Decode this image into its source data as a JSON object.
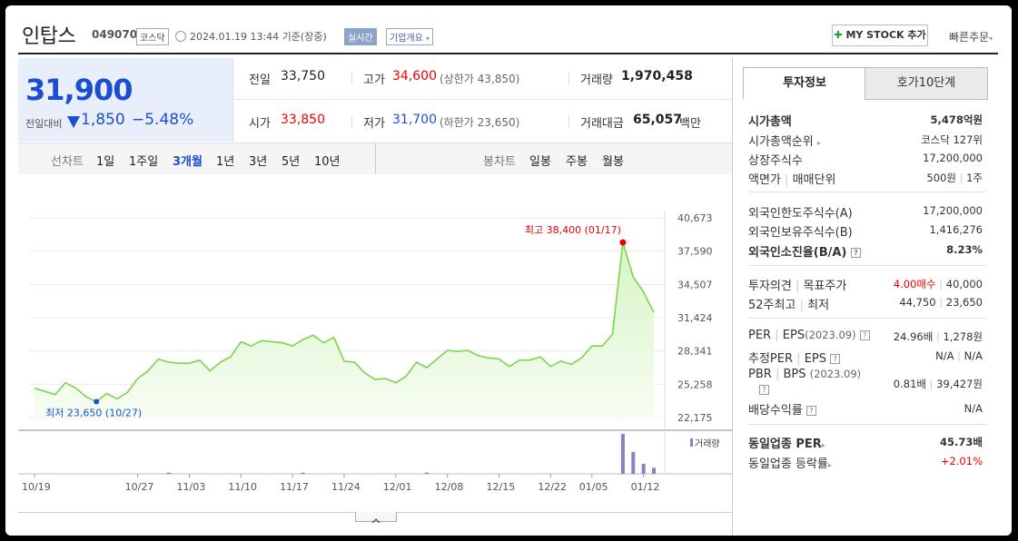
{
  "header": {
    "company_name": "인탑스",
    "code": "049070",
    "market": "코스닥",
    "datetime": "2024.01.19 13:44  기준(장중)",
    "realtime": "실시간",
    "company_info": "기업개요",
    "mystock_button": "MY STOCK 추가",
    "quick_order": "빠른주문"
  },
  "price": {
    "current": "31,900",
    "diff_label": "전일대비",
    "change": "1,850",
    "change_pct": "−5.48%",
    "direction": "down"
  },
  "stats": {
    "prev_close": {
      "label": "전일",
      "value": "33,750"
    },
    "high": {
      "label": "고가",
      "value": "34,600",
      "sub": "(상한가 43,850)"
    },
    "volume": {
      "label": "거래량",
      "value": "1,970,458"
    },
    "open": {
      "label": "시가",
      "value": "33,850"
    },
    "low": {
      "label": "저가",
      "value": "31,700",
      "sub": "(하한가 23,650)"
    },
    "amount": {
      "label": "거래대금",
      "value": "65,057",
      "unit": "백만"
    }
  },
  "period_bar": {
    "line_label": "선차트",
    "line_periods": [
      "1일",
      "1주일",
      "3개월",
      "1년",
      "3년",
      "5년",
      "10년"
    ],
    "active": "3개월",
    "candle_label": "봉차트",
    "candle_periods": [
      "일봉",
      "주봉",
      "월봉"
    ]
  },
  "chart_data": {
    "type": "area",
    "y_ticks": [
      "40,673",
      "37,590",
      "34,507",
      "31,424",
      "28,341",
      "25,258",
      "22,175"
    ],
    "ylim": [
      22175,
      40673
    ],
    "x_ticks": [
      "10/19",
      "10/27",
      "11/03",
      "11/10",
      "11/17",
      "11/24",
      "12/01",
      "12/08",
      "12/15",
      "12/22",
      "01/05",
      "01/12"
    ],
    "high_annotation": "최고 38,400 (01/17)",
    "low_annotation": "최저 23,650 (10/27)",
    "volume_legend": "거래량",
    "prices": [
      24900,
      24600,
      24300,
      25400,
      24900,
      24100,
      23650,
      24400,
      23900,
      24500,
      25800,
      26500,
      27600,
      27300,
      27200,
      27200,
      27500,
      26500,
      27300,
      27800,
      29200,
      28800,
      29300,
      29200,
      29100,
      28800,
      29400,
      29800,
      29100,
      29600,
      27400,
      27300,
      26300,
      25700,
      25800,
      25400,
      26000,
      27300,
      26800,
      27600,
      28400,
      28300,
      28400,
      27900,
      27700,
      27600,
      26900,
      27500,
      27500,
      27800,
      26900,
      27400,
      27100,
      27700,
      28800,
      28800,
      29900,
      38400,
      35200,
      33800,
      31900
    ],
    "volumes": [
      0.02,
      0.02,
      0.02,
      0.02,
      0.02,
      0.02,
      0.02,
      0.02,
      0.02,
      0.02,
      0.02,
      0.02,
      0.02,
      0.03,
      0.02,
      0.02,
      0.02,
      0.02,
      0.02,
      0.02,
      0.02,
      0.02,
      0.02,
      0.02,
      0.02,
      0.02,
      0.03,
      0.02,
      0.02,
      0.02,
      0.02,
      0.02,
      0.02,
      0.02,
      0.02,
      0.02,
      0.02,
      0.02,
      0.03,
      0.02,
      0.02,
      0.02,
      0.02,
      0.02,
      0.02,
      0.02,
      0.02,
      0.02,
      0.02,
      0.02,
      0.02,
      0.02,
      0.02,
      0.02,
      0.02,
      0.02,
      0.02,
      1.0,
      0.55,
      0.25,
      0.15
    ],
    "price_color": "#7ad44f",
    "fill_color": "#d6f5c4",
    "volume_color": "#8f7fc0"
  },
  "tabs": {
    "invest": "투자정보",
    "hoga": "호가10단계"
  },
  "invest": {
    "market_cap": {
      "label": "시가총액",
      "value": "5,478억원"
    },
    "market_cap_rank": {
      "label": "시가총액순위",
      "value": "코스닥 127위"
    },
    "shares": {
      "label": "상장주식수",
      "value": "17,200,000"
    },
    "par_label_a": "액면가",
    "par_label_b": "매매단위",
    "par_value": "500원",
    "par_unit": "1주",
    "foreign_limit": {
      "label": "외국인한도주식수(A)",
      "value": "17,200,000"
    },
    "foreign_holding": {
      "label": "외국인보유주식수(B)",
      "value": "1,416,276"
    },
    "foreign_ratio": {
      "label": "외국인소진율(B/A)",
      "value": "8.23%"
    },
    "opinion_label_a": "투자의견",
    "opinion_label_b": "목표주가",
    "opinion_value": "4.00매수",
    "target_price": "40,000",
    "week52_label_a": "52주최고",
    "week52_label_b": "최저",
    "week52_high": "44,750",
    "week52_low": "23,650",
    "per_label": "PER",
    "eps_label": "EPS",
    "per_period": "(2023.09)",
    "per_value": "24.96배",
    "eps_value": "1,278원",
    "est_per_label": "추정PER",
    "est_eps_label": "EPS",
    "est_per_value": "N/A",
    "est_eps_value": "N/A",
    "pbr_label": "PBR",
    "bps_label": "BPS",
    "bps_period": "(2023.09)",
    "pbr_value": "0.81배",
    "bps_value": "39,427원",
    "dividend_label": "배당수익률",
    "dividend_value": "N/A",
    "industry_per": {
      "label": "동일업종 PER",
      "value": "45.73배"
    },
    "industry_change": {
      "label": "동일업종 등락률",
      "value": "+2.01%"
    }
  }
}
